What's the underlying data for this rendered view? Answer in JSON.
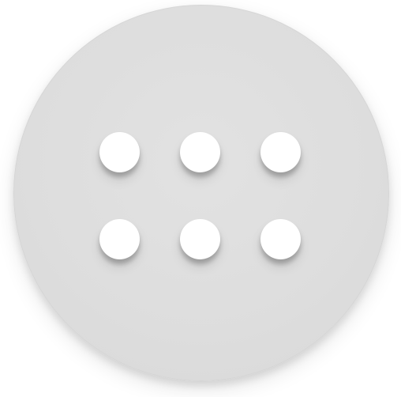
{
  "launcher": {
    "icon": "app-grid-icon",
    "dot_count": 6,
    "grid_rows": 2,
    "grid_cols": 3,
    "colors": {
      "button_fill": "#dddddd",
      "dot_fill": "#ffffff",
      "page_background": "#ffffff"
    }
  }
}
